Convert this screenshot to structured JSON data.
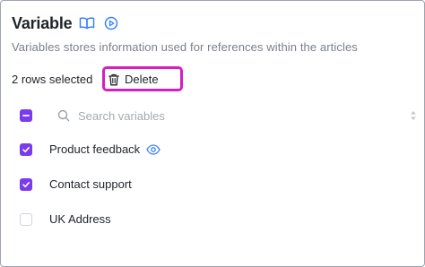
{
  "header": {
    "title": "Variable",
    "subtitle": "Variables stores information used for references within the articles",
    "icons": [
      "book-icon",
      "play-circle-icon"
    ]
  },
  "selection": {
    "count_label": "2 rows selected",
    "delete_label": "Delete"
  },
  "search": {
    "placeholder": "Search variables",
    "value": ""
  },
  "rows": [
    {
      "label": "Product feedback",
      "checked": true,
      "icon": "eye-icon"
    },
    {
      "label": "Contact support",
      "checked": true
    },
    {
      "label": "UK Address",
      "checked": false
    }
  ],
  "colors": {
    "accent": "#7c3aed",
    "highlight": "#d61fbf",
    "icon_blue": "#3b82f6"
  }
}
